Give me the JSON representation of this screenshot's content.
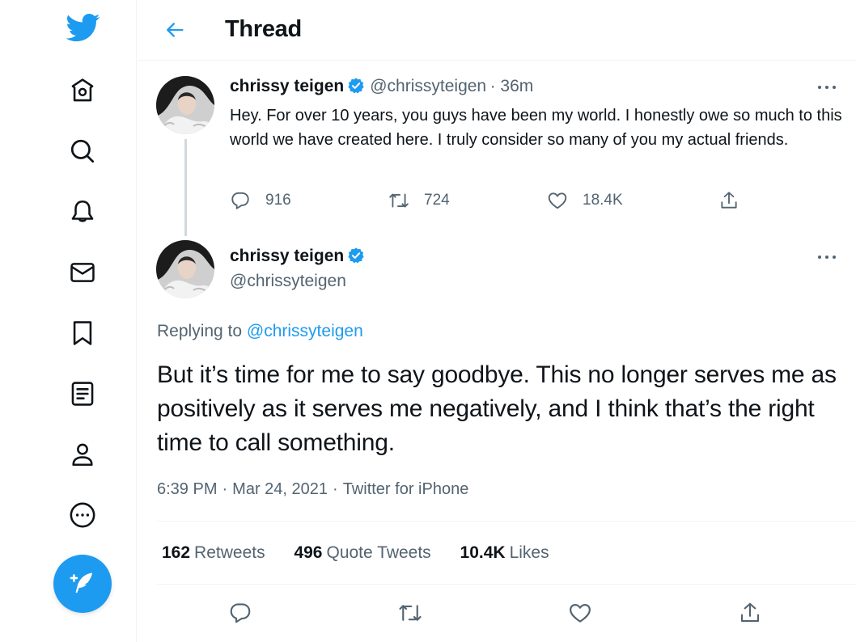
{
  "header": {
    "title": "Thread"
  },
  "tweet1": {
    "name": "chrissy teigen",
    "handle": "@chrissyteigen",
    "time": "· 36m",
    "text": "Hey. For over 10 years, you guys have been my world. I honestly owe so much to this world we have created here. I truly consider so many of you my actual friends.",
    "replies": "916",
    "retweets": "724",
    "likes": "18.4K"
  },
  "tweet2": {
    "name": "chrissy teigen",
    "handle": "@chrissyteigen",
    "replying_prefix": "Replying to",
    "replying_to": "@chrissyteigen",
    "text": "But it’s time for me to say goodbye. This no longer serves me as positively as it serves me negatively, and I think that’s the right time to call something.",
    "time": "6:39 PM",
    "date": "Mar 24, 2021",
    "source": "Twitter for iPhone",
    "retweets_count": "162",
    "retweets_label": "Retweets",
    "quotes_count": "496",
    "quotes_label": "Quote Tweets",
    "likes_count": "10.4K",
    "likes_label": "Likes"
  },
  "icons": {
    "sidebar": [
      "twitter-logo-icon",
      "home-icon",
      "explore-icon",
      "notifications-icon",
      "messages-icon",
      "bookmarks-icon",
      "lists-icon",
      "profile-icon",
      "more-icon",
      "compose-icon"
    ],
    "actions": [
      "reply-icon",
      "retweet-icon",
      "like-icon",
      "share-icon"
    ]
  },
  "colors": {
    "accent": "#1d9bf0",
    "text": "#0f1419",
    "secondary": "#536471",
    "border": "#eff3f4"
  }
}
